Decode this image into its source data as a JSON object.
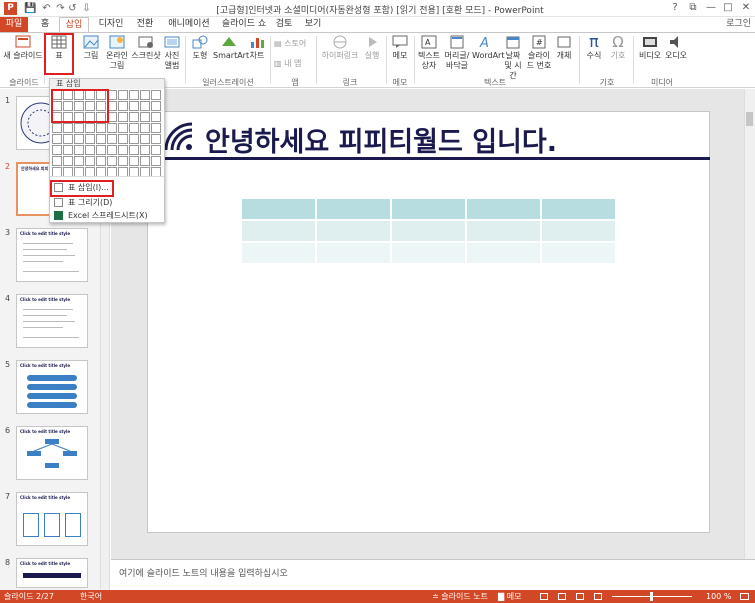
{
  "window": {
    "app_letter": "P",
    "title": "[고급형]인터넷과 소셜미디어(자동완성형 포함) [읽기 전용] [호환 모드] - PowerPoint",
    "help": "?",
    "restore": "⧉",
    "minimize": "—",
    "maximize": "□",
    "close": "✕"
  },
  "qat": {
    "save": "💾",
    "undo": "↶",
    "redo": "↷",
    "repeat": "↺",
    "customize": "⇩"
  },
  "tabs": [
    "파일",
    "홈",
    "삽입",
    "디자인",
    "전환",
    "애니메이션",
    "슬라이드 쇼",
    "검토",
    "보기"
  ],
  "signin": "로그인",
  "ribbon": {
    "new_slide": "새 슬라이드",
    "table": "표",
    "picture": "그림",
    "online_picture_1": "온라인",
    "online_picture_2": "그림",
    "screenshot": "스크린샷",
    "album_1": "사진",
    "album_2": "앨범",
    "shapes": "도형",
    "smartart": "SmartArt",
    "chart": "차트",
    "store": "스토어",
    "my_apps": "내 앱",
    "hyperlink": "하이퍼링크",
    "action": "실행",
    "comment": "메모",
    "textbox_1": "텍스트",
    "textbox_2": "상자",
    "header_1": "머리글/",
    "header_2": "바닥글",
    "wordart": "WordArt",
    "datetime_1": "날짜",
    "datetime_2": "및 시간",
    "slidenum_1": "슬라이",
    "slidenum_2": "드 번호",
    "object": "개체",
    "equation": "수식",
    "symbol": "기호",
    "video": "비디오",
    "audio": "오디오",
    "groups": {
      "slides": "슬라이드",
      "illustrations": "일러스트레이션",
      "apps": "앱",
      "links": "링크",
      "comments": "메모",
      "text": "텍스트",
      "symbols": "기호",
      "media": "미디어"
    }
  },
  "dropdown": {
    "header": "표 삽입",
    "insert_table": "표 삽입(I)...",
    "draw_table": "표 그리기(D)",
    "excel": "Excel 스프레드시트(X)"
  },
  "thumbnails": [
    "1",
    "2",
    "3",
    "4",
    "5",
    "6",
    "7",
    "8"
  ],
  "thumb_texts": {
    "t2": "안녕하세요 피피",
    "t3": "Click to edit title style",
    "t4": "Click to edit title style",
    "t5": "Click to edit title style",
    "t6": "Click to edit title style",
    "t7": "Click to edit title style",
    "t8": "Click to edit title style"
  },
  "slide": {
    "title": "안녕하세요 피피티월드 입니다."
  },
  "notes": "여기에 슬라이드 노트의 내용을 입력하십시오",
  "status": {
    "slide": "슬라이드 2/27",
    "lang": "한국어",
    "notes": "슬라이드 노트",
    "comments": "메모",
    "zoom": "100 %"
  },
  "colors": {
    "accent": "#d24726",
    "title": "#1a1a4e",
    "table_head": "#b7dde0",
    "table_row1": "#dfeff0",
    "table_row2": "#edf6f7"
  }
}
